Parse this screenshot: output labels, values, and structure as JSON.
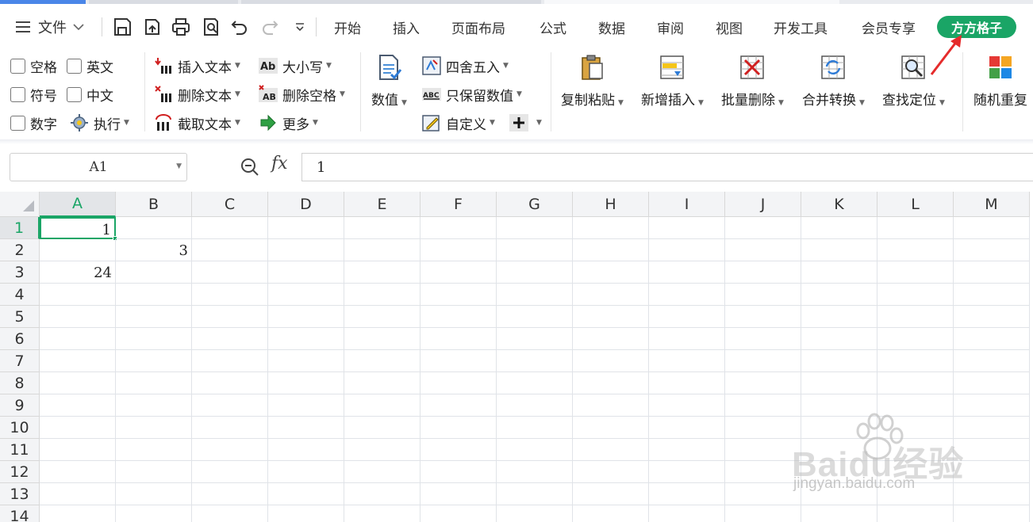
{
  "menu": {
    "file_label": "文件",
    "tabs": [
      "开始",
      "插入",
      "页面布局",
      "公式",
      "数据",
      "审阅",
      "视图",
      "开发工具",
      "会员专享"
    ],
    "active_tab": "方方格子"
  },
  "ribbon": {
    "checkboxes": {
      "space": "空格",
      "english": "英文",
      "symbol": "符号",
      "chinese": "中文",
      "number": "数字"
    },
    "execute": "执行",
    "text_group": {
      "insert": "插入文本",
      "delete": "删除文本",
      "extract": "截取文本"
    },
    "case_group": {
      "case": "大小写",
      "delete_space": "删除空格",
      "more": "更多"
    },
    "value_label": "数值",
    "number_group": {
      "round": "四舍五入",
      "keep_value": "只保留数值",
      "custom": "自定义"
    },
    "big_buttons": {
      "copy_paste": "复制粘贴",
      "new_insert": "新增插入",
      "batch_delete": "批量删除",
      "merge_convert": "合并转换",
      "find_locate": "查找定位",
      "random_repeat": "随机重复"
    }
  },
  "formula_bar": {
    "name_box": "A1",
    "fx": "fx",
    "content": "1"
  },
  "sheet": {
    "columns": [
      "A",
      "B",
      "C",
      "D",
      "E",
      "F",
      "G",
      "H",
      "I",
      "J",
      "K",
      "L",
      "M"
    ],
    "rows": [
      "1",
      "2",
      "3",
      "4",
      "5",
      "6",
      "7",
      "8",
      "9",
      "10",
      "11",
      "12",
      "13",
      "14"
    ],
    "cells": {
      "A1": "1",
      "B2": "3",
      "A3": "24"
    },
    "active_cell": "A1"
  },
  "colors": {
    "accent": "#1aa566",
    "arrow": "#e52b2b"
  },
  "watermark": {
    "brand": "Baidu经验",
    "url": "jingyan.baidu.com"
  }
}
